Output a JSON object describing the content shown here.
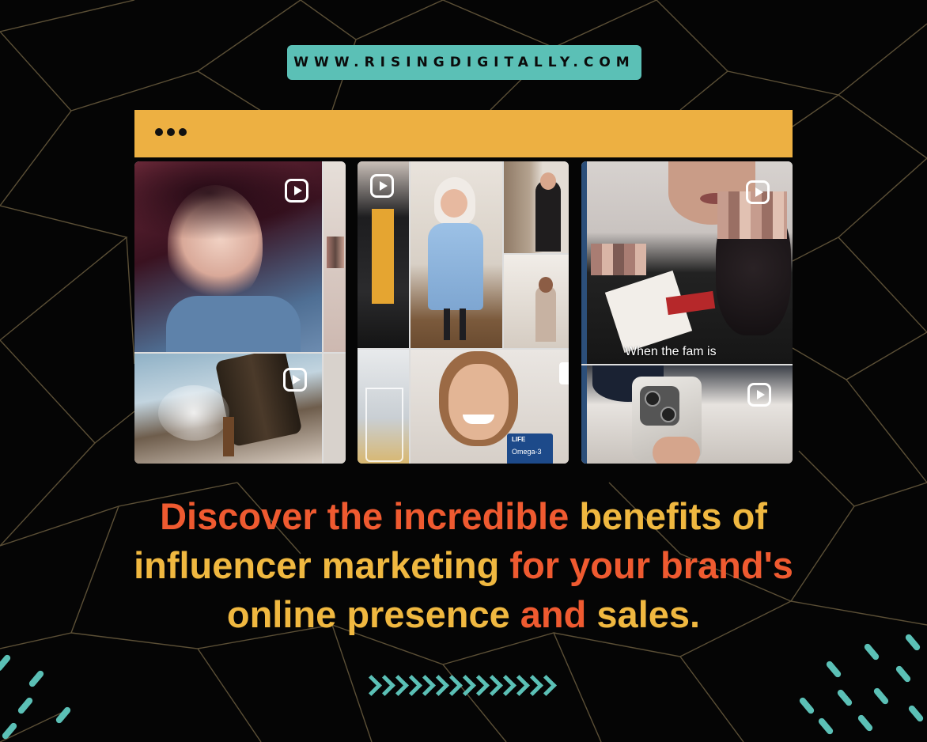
{
  "website": "WWW.RISINGDIGITALLY.COM",
  "colors": {
    "background": "#050505",
    "teal": "#5bc0b6",
    "mustard": "#edb042",
    "orange": "#ef5a30",
    "yellow": "#f0b840"
  },
  "browser": {
    "menu_icon": "three-dots-icon"
  },
  "reels": {
    "icon": "reel-play-icon",
    "caption": "When the fam is",
    "product_label_1": "LIFE",
    "product_label_2": "Omega-3"
  },
  "headline": {
    "l1_a": "Discover the incredible",
    "l1_b": "benefits of",
    "l2_a": "influencer marketing",
    "l2_b": "for your brand's",
    "l3_a": "online presence",
    "l3_b": "and",
    "l3_c": "sales."
  },
  "decor": {
    "arrows_icon": "chevron-right-row-icon"
  }
}
